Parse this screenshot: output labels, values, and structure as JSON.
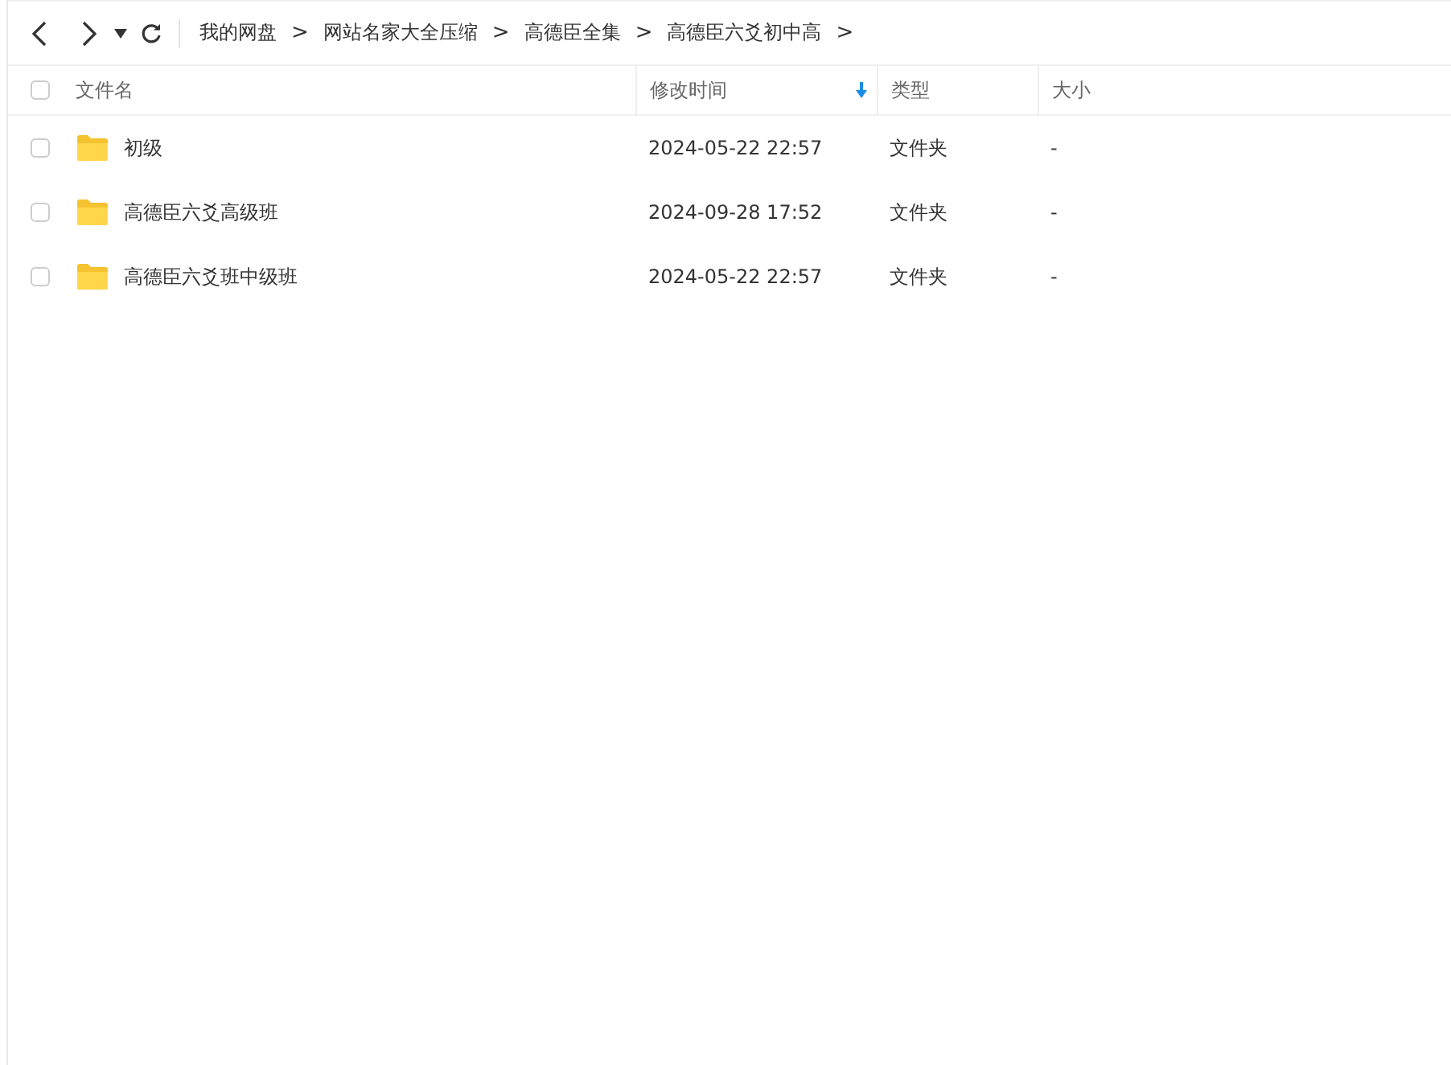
{
  "breadcrumb": [
    "我的网盘",
    "网站名家大全压缩",
    "高德臣全集",
    "高德臣六爻初中高"
  ],
  "breadcrumb_separator": ">",
  "table": {
    "select_all_checked": false,
    "columns": [
      {
        "label": "文件名",
        "sorted": false
      },
      {
        "label": "修改时间",
        "sorted": true
      },
      {
        "label": "类型",
        "sorted": false
      },
      {
        "label": "大小",
        "sorted": false
      }
    ],
    "rows": [
      {
        "checked": false,
        "name": "初级",
        "modified": "2024-05-22 22:57",
        "type": "文件夹",
        "size": "-"
      },
      {
        "checked": false,
        "name": "高德臣六爻高级班",
        "modified": "2024-09-28 17:52",
        "type": "文件夹",
        "size": "-"
      },
      {
        "checked": false,
        "name": "高德臣六爻班中级班",
        "modified": "2024-05-22 22:57",
        "type": "文件夹",
        "size": "-"
      }
    ]
  }
}
